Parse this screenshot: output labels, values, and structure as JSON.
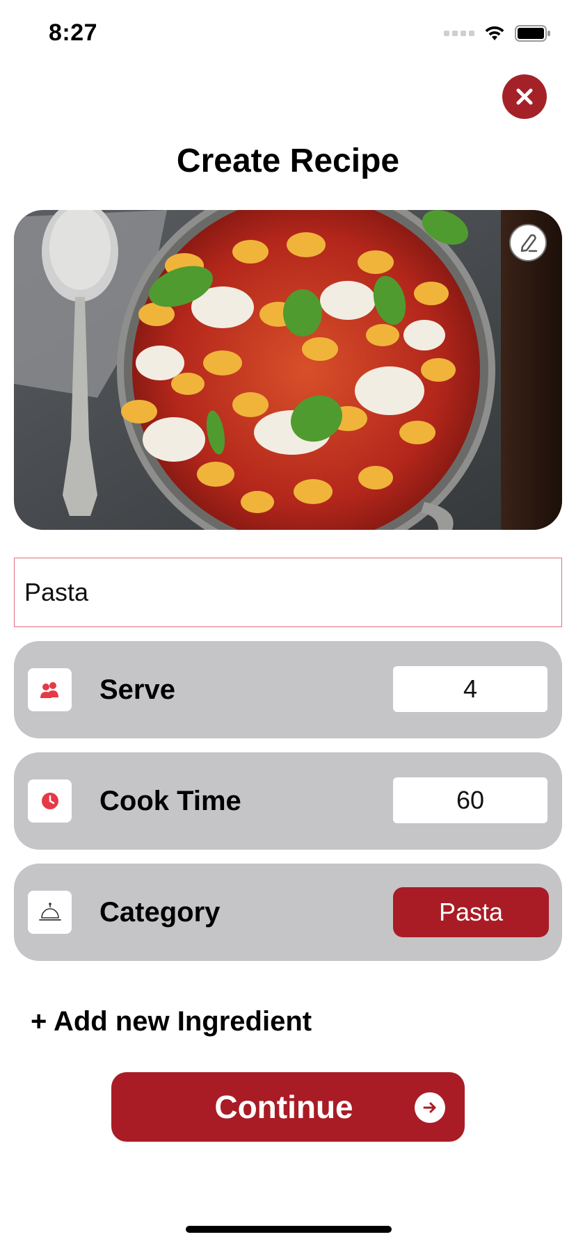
{
  "status_bar": {
    "time": "8:27"
  },
  "header": {
    "title": "Create Recipe"
  },
  "icons": {
    "close": "close-icon",
    "edit_image": "pencil-icon",
    "serve": "people-icon",
    "cook_time": "clock-icon",
    "category": "cloche-icon",
    "continue_arrow": "arrow-right-icon"
  },
  "recipe": {
    "name_value": "Pasta"
  },
  "fields": {
    "serve": {
      "label": "Serve",
      "value": "4"
    },
    "cook_time": {
      "label": "Cook Time",
      "value": "60"
    },
    "category": {
      "label": "Category",
      "value": "Pasta"
    }
  },
  "actions": {
    "add_ingredient": "+ Add new Ingredient",
    "continue": "Continue"
  },
  "colors": {
    "accent": "#a91c25",
    "row_background": "#c5c5c7",
    "icon_red": "#e63946"
  }
}
